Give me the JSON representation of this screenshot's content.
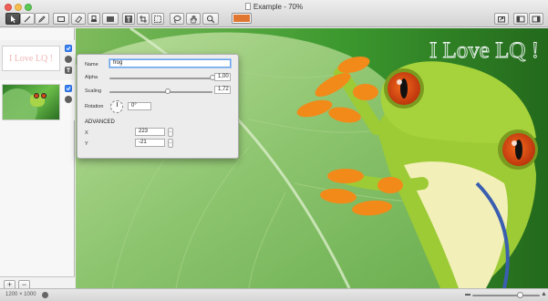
{
  "window": {
    "title": "Example - 70%"
  },
  "colors": {
    "fill_well": "#e0762f"
  },
  "toolbar": {
    "tools": [
      {
        "name": "pointer-tool",
        "icon": "pointer-icon"
      },
      {
        "name": "line-tool",
        "icon": "line-icon"
      },
      {
        "name": "pen-tool",
        "icon": "pen-icon"
      },
      {
        "name": "shape-tool",
        "icon": "rectangle-icon"
      },
      {
        "name": "eraser-tool",
        "icon": "eraser-icon"
      },
      {
        "name": "stamp-tool",
        "icon": "stamp-icon"
      },
      {
        "name": "fill-tool",
        "icon": "fill-icon"
      },
      {
        "name": "text-tool",
        "icon": "text-icon"
      },
      {
        "name": "crop-tool",
        "icon": "crop-icon"
      },
      {
        "name": "lasso-tool",
        "icon": "lasso-icon"
      },
      {
        "name": "magic-wand-tool",
        "icon": "wand-icon"
      },
      {
        "name": "hand-tool",
        "icon": "hand-icon"
      },
      {
        "name": "zoom-tool",
        "icon": "magnifier-icon"
      }
    ],
    "right_buttons": [
      {
        "name": "share-button",
        "icon": "share-icon"
      },
      {
        "name": "sidebar-toggle-button",
        "icon": "sidebar-icon"
      },
      {
        "name": "inspector-toggle-button",
        "icon": "inspector-icon"
      }
    ]
  },
  "sidebar": {
    "layers": [
      {
        "name": "text-layer",
        "thumb_text": "I Love LQ !"
      },
      {
        "name": "frog-layer",
        "thumb_text": ""
      }
    ],
    "add_label": "+",
    "remove_label": "−"
  },
  "canvas": {
    "overlay_text": "I Love LQ !"
  },
  "inspector": {
    "name_label": "Name",
    "name_value": "frog",
    "alpha_label": "Alpha",
    "alpha_value": "1,00",
    "alpha_level": 1.0,
    "scaling_label": "Scaling",
    "scaling_value": "1,72",
    "scaling_level": 0.57,
    "rotation_label": "Rotation",
    "rotation_value": "0°",
    "advanced_label": "ADVANCED",
    "x_label": "X",
    "x_value": "223",
    "y_label": "Y",
    "y_value": "-21"
  },
  "status": {
    "image_size": "1200 × 1000",
    "zoom_level": 0.7
  }
}
